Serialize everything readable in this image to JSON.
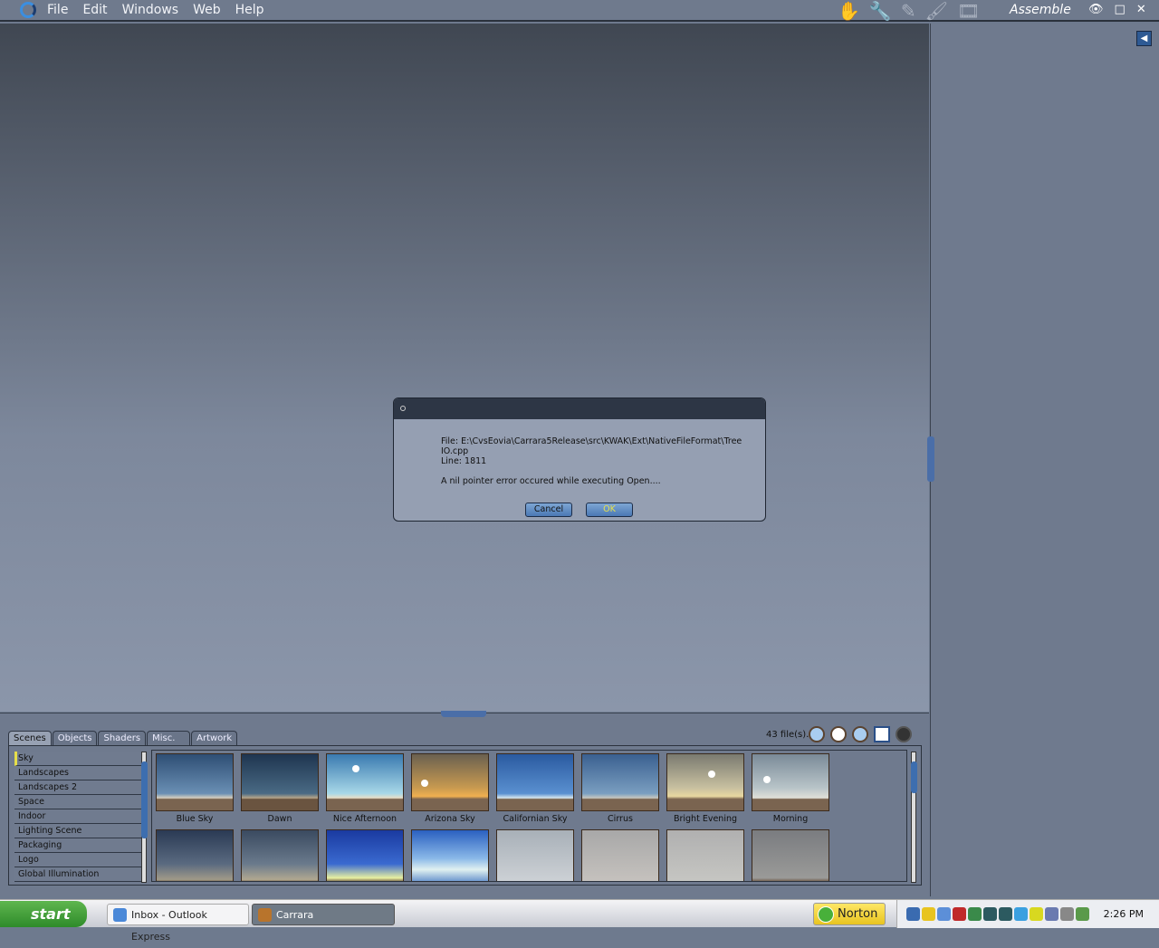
{
  "menubar": {
    "items": [
      "File",
      "Edit",
      "Windows",
      "Web",
      "Help"
    ],
    "room": "Assemble",
    "tools": [
      "hand-icon",
      "wrench-icon",
      "pencil-icon",
      "brush-icon",
      "film-icon"
    ]
  },
  "dialog": {
    "message": "File: E:\\CvsEovia\\Carrara5Release\\src\\KWAK\\Ext\\NativeFileFormat\\TreeIO.cpp",
    "line": "Line: 1811",
    "error": "A nil pointer error occured while executing Open....",
    "cancel": "Cancel",
    "ok": "OK"
  },
  "browser": {
    "tabs": [
      "Scenes",
      "Objects",
      "Shaders",
      "Misc.",
      "Artwork"
    ],
    "file_count": "43 file(s).",
    "categories": [
      "Sky",
      "Landscapes",
      "Landscapes 2",
      "Space",
      "Indoor",
      "Lighting Scene",
      "Packaging",
      "Logo",
      "Global Illumination"
    ],
    "thumbs": [
      "Blue Sky",
      "Dawn",
      "Nice Afternoon",
      "Arizona Sky",
      "Californian Sky",
      "Cirrus",
      "Bright Evening",
      "Morning"
    ]
  },
  "taskbar": {
    "start": "start",
    "tasks": [
      "Inbox - Outlook Express",
      "Carrara"
    ],
    "norton": "Norton",
    "clock": "2:26 PM"
  }
}
